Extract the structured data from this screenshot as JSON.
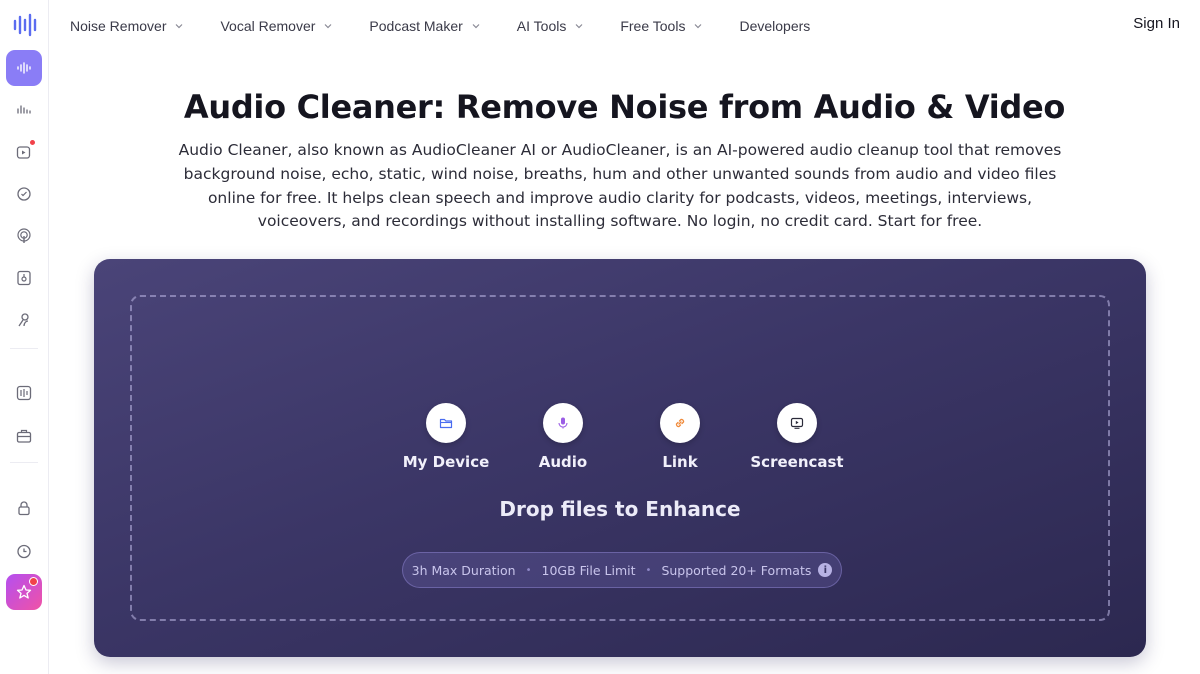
{
  "nav": {
    "items": [
      {
        "label": "Noise Remover",
        "has_dropdown": true
      },
      {
        "label": "Vocal Remover",
        "has_dropdown": true
      },
      {
        "label": "Podcast Maker",
        "has_dropdown": true
      },
      {
        "label": "AI Tools",
        "has_dropdown": true
      },
      {
        "label": "Free Tools",
        "has_dropdown": true
      },
      {
        "label": "Developers",
        "has_dropdown": false
      }
    ],
    "sign_in": "Sign In"
  },
  "sidebar": {
    "items": [
      {
        "icon": "waveform-icon",
        "active": true
      },
      {
        "icon": "audio-enhance-icon"
      },
      {
        "icon": "video-icon",
        "badge": true
      },
      {
        "icon": "speed-icon"
      },
      {
        "icon": "podcast-icon"
      },
      {
        "icon": "file-audio-icon"
      },
      {
        "icon": "voice-icon"
      },
      {
        "icon": "equalizer-icon"
      },
      {
        "icon": "toolbox-icon"
      },
      {
        "icon": "lock-icon"
      },
      {
        "icon": "history-icon"
      },
      {
        "icon": "star-icon",
        "badge": true
      }
    ]
  },
  "hero": {
    "title": "Audio Cleaner: Remove Noise from Audio & Video",
    "description": "Audio Cleaner, also known as AudioCleaner AI or AudioCleaner, is an AI-powered audio cleanup tool that removes background noise, echo, static, wind noise, breaths, hum and other unwanted sounds from audio and video files online for free. It helps clean speech and improve audio clarity for podcasts, videos, meetings, interviews, voiceovers, and recordings without installing software. No login, no credit card. Start for free."
  },
  "upload": {
    "sources": [
      {
        "label": "My Device",
        "icon": "folder-icon"
      },
      {
        "label": "Audio",
        "icon": "microphone-icon"
      },
      {
        "label": "Link",
        "icon": "link-icon"
      },
      {
        "label": "Screencast",
        "icon": "screen-icon"
      }
    ],
    "drop_text": "Drop files to Enhance",
    "limits": [
      "3h Max Duration",
      "10GB File Limit",
      "Supported 20+ Formats"
    ]
  },
  "colors": {
    "panel_bg": "#3b3666",
    "accent": "#8a7df6",
    "badge_red": "#f1424a"
  }
}
